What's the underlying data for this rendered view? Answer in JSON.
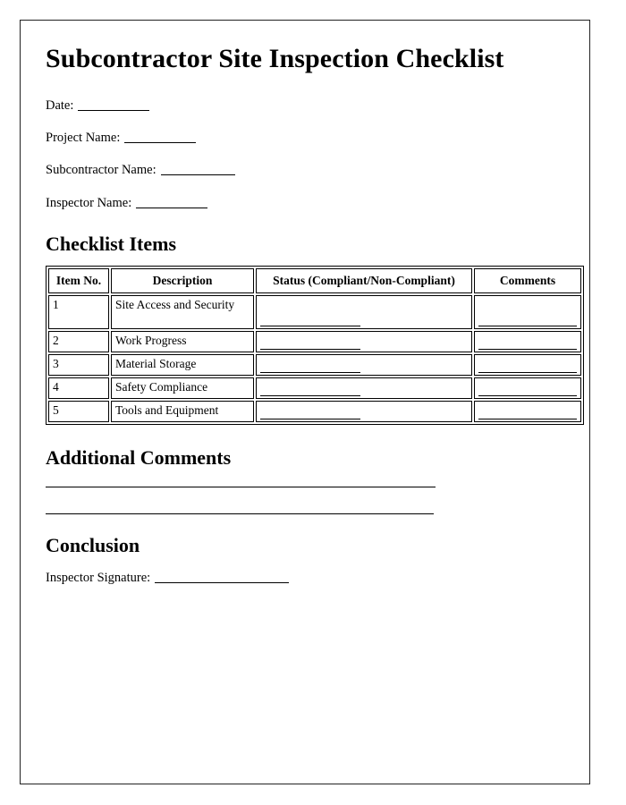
{
  "document": {
    "title": "Subcontractor Site Inspection Checklist"
  },
  "fields": [
    {
      "label": "Date:",
      "value": ""
    },
    {
      "label": "Project Name:",
      "value": ""
    },
    {
      "label": "Subcontractor Name:",
      "value": ""
    },
    {
      "label": "Inspector Name:",
      "value": ""
    }
  ],
  "checklist_section": {
    "heading": "Checklist Items",
    "columns": [
      "Item No.",
      "Description",
      "Status (Compliant/Non-Compliant)",
      "Comments"
    ],
    "rows": [
      {
        "no": "1",
        "description": "Site Access and Security",
        "status": "",
        "comments": ""
      },
      {
        "no": "2",
        "description": "Work Progress",
        "status": "",
        "comments": ""
      },
      {
        "no": "3",
        "description": "Material Storage",
        "status": "",
        "comments": ""
      },
      {
        "no": "4",
        "description": "Safety Compliance",
        "status": "",
        "comments": ""
      },
      {
        "no": "5",
        "description": "Tools and Equipment",
        "status": "",
        "comments": ""
      }
    ]
  },
  "additional_comments": {
    "heading": "Additional Comments",
    "lines": [
      "",
      ""
    ]
  },
  "conclusion": {
    "heading": "Conclusion",
    "signature_label": "Inspector Signature:",
    "signature_value": ""
  }
}
